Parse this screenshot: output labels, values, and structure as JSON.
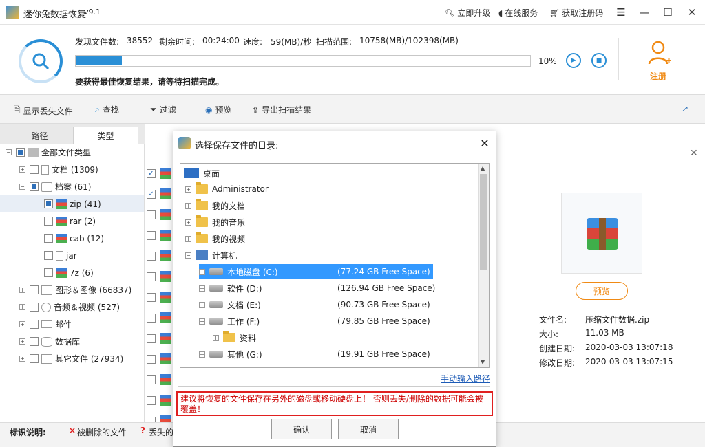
{
  "titlebar": {
    "app_title": "迷你兔数据恢复",
    "version": "v9.1",
    "upgrade": "立即升级",
    "online_service": "在线服务",
    "get_code": "获取注册码"
  },
  "scan": {
    "files_found_label": "发现文件数:",
    "files_found": "38552",
    "time_left_label": "剩余时间:",
    "time_left": "00:24:00",
    "speed_label": "速度:",
    "speed": "59(MB)/秒",
    "range_label": "扫描范围:",
    "range": "10758(MB)/102398(MB)",
    "progress_pct": "10%",
    "progress_value": 0.1,
    "hint": "要获得最佳恢复结果，请等待扫描完成。",
    "register": "注册"
  },
  "toolbar": {
    "show_lost": "显示丢失文件",
    "find": "查找",
    "filter": "过滤",
    "preview": "预览",
    "export": "导出扫描结果"
  },
  "tabs": {
    "path": "路径",
    "type": "类型"
  },
  "tree": {
    "root": "全部文件类型",
    "docs": "文档 (1309)",
    "archives": "档案 (61)",
    "zip": "zip (41)",
    "rar": "rar (2)",
    "cab": "cab (12)",
    "jar": "jar",
    "sevenz": "7z (6)",
    "images": "图形＆图像 (66837)",
    "media": "音频＆视频 (527)",
    "mail": "邮件",
    "database": "数据库",
    "others": "其它文件 (27934)"
  },
  "preview": {
    "button": "预览",
    "name_label": "文件名:",
    "name": "压缩文件数据.zip",
    "size_label": "大小:",
    "size": "11.03 MB",
    "created_label": "创建日期:",
    "created": "2020-03-03 13:07:18",
    "modified_label": "修改日期:",
    "modified": "2020-03-03 13:07:15"
  },
  "legend": {
    "title": "标识说明:",
    "deleted": "被删除的文件",
    "lost": "丢失的"
  },
  "dialog": {
    "title": "选择保存文件的目录:",
    "desktop": "桌面",
    "admin": "Administrator",
    "my_docs": "我的文档",
    "my_music": "我的音乐",
    "my_video": "我的视频",
    "computer": "计算机",
    "drive_c": "本地磁盘 (C:)",
    "drive_c_free": "(77.24 GB Free Space)",
    "drive_d": "软件 (D:)",
    "drive_d_free": "(126.94 GB Free Space)",
    "drive_e": "文档 (E:)",
    "drive_e_free": "(90.73 GB Free Space)",
    "drive_f": "工作 (F:)",
    "drive_f_free": "(79.85 GB Free Space)",
    "folder_ziliao": "资料",
    "drive_g": "其他 (G:)",
    "drive_g_free": "(19.91 GB Free Space)",
    "manual_path": "手动输入路径",
    "warning": "建议将恢复的文件保存在另外的磁盘或移动硬盘上！ 否则丢失/删除的数据可能会被覆盖！",
    "confirm": "确认",
    "cancel": "取消"
  },
  "colors": {
    "accent": "#2a8fd6",
    "orange": "#f08a14",
    "warning": "#e02020"
  }
}
